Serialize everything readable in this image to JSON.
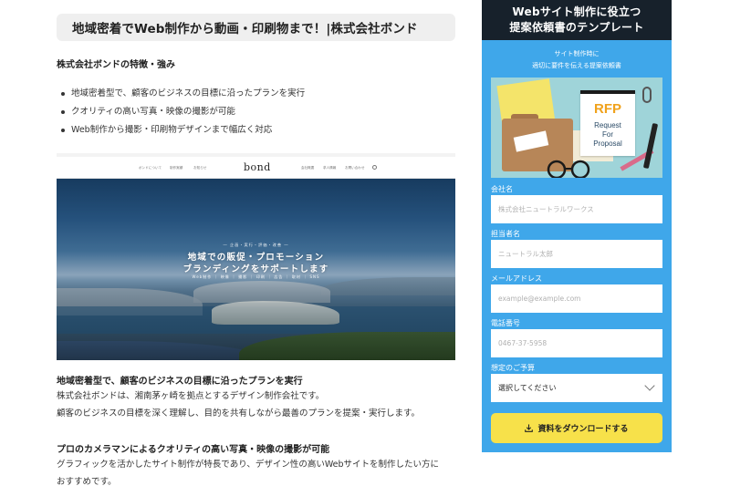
{
  "article": {
    "heading": "地域密着でWeb制作から動画・印刷物まで！|株式会社ボンド",
    "features_title": "株式会社ボンドの特徴・強み",
    "features": [
      "地域密着型で、顧客のビジネスの目標に沿ったプランを実行",
      "クオリティの高い写真・映像の撮影が可能",
      "Web制作から撮影・印刷物デザインまで幅広く対応"
    ],
    "hero": {
      "logo": "bond",
      "nav_left": [
        "ボンドについて",
        "制作実績",
        "お知らせ"
      ],
      "nav_right": [
        "会社概要",
        "求人情報",
        "お問い合わせ"
      ],
      "kicker": "― 企画・実行・評価・改善 ―",
      "line1": "地域での販促・プロモーション",
      "line2": "ブランディングをサポートします",
      "services": "Web制作 ｜ 映像 ｜ 撮影 ｜ 印刷 ｜ 広告 ｜ 取材 ｜ SNS"
    },
    "section1": {
      "title": "地域密着型で、顧客のビジネスの目標に沿ったプランを実行",
      "lines": [
        "株式会社ボンドは、湘南茅ヶ崎を拠点とするデザイン制作会社です。",
        "顧客のビジネスの目標を深く理解し、目的を共有しながら最善のプランを提案・実行します。"
      ]
    },
    "section2": {
      "title": "プロのカメラマンによるクオリティの高い写真・映像の撮影が可能",
      "lines": [
        "グラフィックを活かしたサイト制作が特長であり、デザイン性の高いWebサイトを制作したい方に",
        "おすすめです。"
      ]
    }
  },
  "sidebar": {
    "title_line1": "Webサイト制作に役立つ",
    "title_line2": "提案依頼書のテンプレート",
    "desc_line1": "サイト制作時に",
    "desc_line2": "適切に要件を伝える提案依頼書",
    "illustration": {
      "rfp": "RFP",
      "rfp_line1": "Request",
      "rfp_line2": "For",
      "rfp_line3": "Proposal"
    },
    "fields": {
      "company": {
        "label": "会社名",
        "placeholder": "株式会社ニュートラルワークス"
      },
      "person": {
        "label": "担当者名",
        "placeholder": "ニュートラル太郎"
      },
      "email": {
        "label": "メールアドレス",
        "placeholder": "example@example.com"
      },
      "phone": {
        "label": "電話番号",
        "placeholder": "0467-37-5958"
      },
      "budget": {
        "label": "想定のご予算",
        "selected": "選択してください"
      }
    },
    "download_label": "資料をダウンロードする"
  },
  "colors": {
    "sidebar_bg": "#3fa7ea",
    "sidebar_header": "#17212b",
    "button": "#f7e14a",
    "heading_bar": "#efefef"
  }
}
